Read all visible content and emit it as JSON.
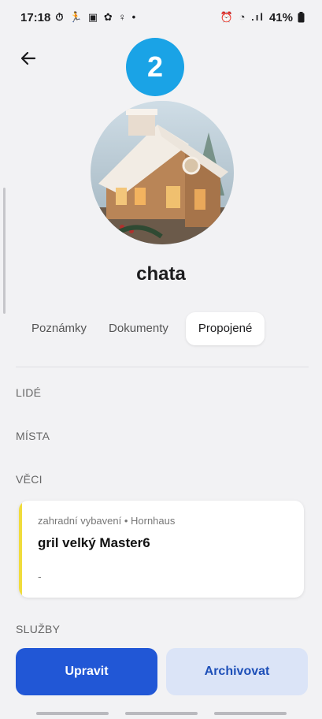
{
  "status_bar": {
    "time": "17:18",
    "left_icons": "⏱ 🏃 ▣ ✿ ♀ •",
    "right_icons": "⏰ ◔ .ıl",
    "battery": "41%"
  },
  "step_badge": "2",
  "item": {
    "name": "chata"
  },
  "tabs": [
    {
      "label": "Poznámky",
      "active": false
    },
    {
      "label": "Dokumenty",
      "active": false
    },
    {
      "label": "Propojené",
      "active": true
    }
  ],
  "sections": {
    "people": "LIDÉ",
    "places": "MÍSTA",
    "things": "VĚCI",
    "services": "SLUŽBY"
  },
  "card": {
    "subtitle": "zahradní vybavení • Hornhaus",
    "title": "gril velký Master6",
    "note": "-",
    "accent_color": "#f0dc3c"
  },
  "actions": {
    "edit": "Upravit",
    "archive": "Archivovat"
  },
  "colors": {
    "primary": "#2157d6",
    "secondary_bg": "#dbe4f7",
    "badge": "#1aa3e6"
  }
}
